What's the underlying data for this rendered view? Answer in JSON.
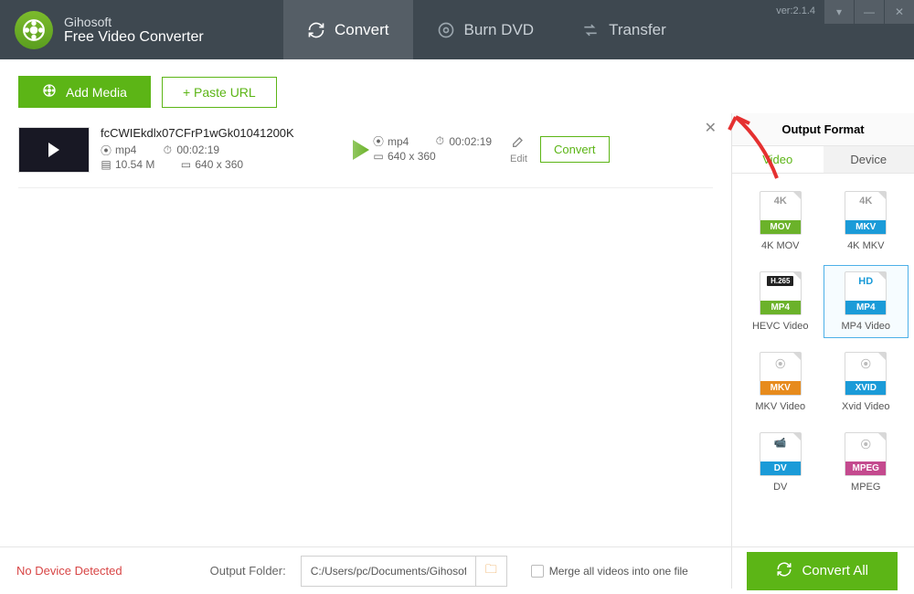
{
  "brand": {
    "line1": "Gihosoft",
    "line2": "Free Video Converter"
  },
  "nav": {
    "convert": "Convert",
    "burn": "Burn DVD",
    "transfer": "Transfer"
  },
  "version": "ver:2.1.4",
  "toolbar": {
    "add": "Add Media",
    "paste": "+ Paste URL"
  },
  "file": {
    "name": "fcCWIEkdlx07CFrP1wGk01041200K",
    "in_format": "mp4",
    "in_duration": "00:02:19",
    "in_size": "10.54 M",
    "in_res": "640 x 360",
    "out_format": "mp4",
    "out_duration": "00:02:19",
    "out_res": "640 x 360",
    "edit": "Edit",
    "convert": "Convert"
  },
  "panel": {
    "title": "Output Format",
    "tab_video": "Video",
    "tab_device": "Device",
    "formats": [
      {
        "top": "4K",
        "band": "MOV",
        "bandColor": "#6bb22a",
        "topColor": "#999",
        "label": "4K MOV"
      },
      {
        "top": "4K",
        "band": "MKV",
        "bandColor": "#1b9bd8",
        "topColor": "#999",
        "label": "4K MKV"
      },
      {
        "top": "H.265",
        "band": "MP4",
        "bandColor": "#6bb22a",
        "topColor": "#fff",
        "topBg": "#222",
        "label": "HEVC Video"
      },
      {
        "top": "HD",
        "band": "MP4",
        "bandColor": "#1b9bd8",
        "topColor": "#1b9bd8",
        "label": "MP4 Video",
        "selected": true
      },
      {
        "top": "⦿",
        "band": "MKV",
        "bandColor": "#e78b1d",
        "topColor": "#bbb",
        "label": "MKV Video"
      },
      {
        "top": "⦿",
        "band": "XVID",
        "bandColor": "#1b9bd8",
        "topColor": "#bbb",
        "label": "Xvid Video"
      },
      {
        "top": "📹",
        "band": "DV",
        "bandColor": "#1b9bd8",
        "topColor": "#555",
        "label": "DV"
      },
      {
        "top": "⦿",
        "band": "MPEG",
        "bandColor": "#c44a8e",
        "topColor": "#bbb",
        "label": "MPEG"
      }
    ]
  },
  "footer": {
    "no_device": "No Device Detected",
    "folder_label": "Output Folder:",
    "folder_path": "C:/Users/pc/Documents/Gihosoft/Free",
    "merge": "Merge all videos into one file",
    "convert_all": "Convert All"
  }
}
